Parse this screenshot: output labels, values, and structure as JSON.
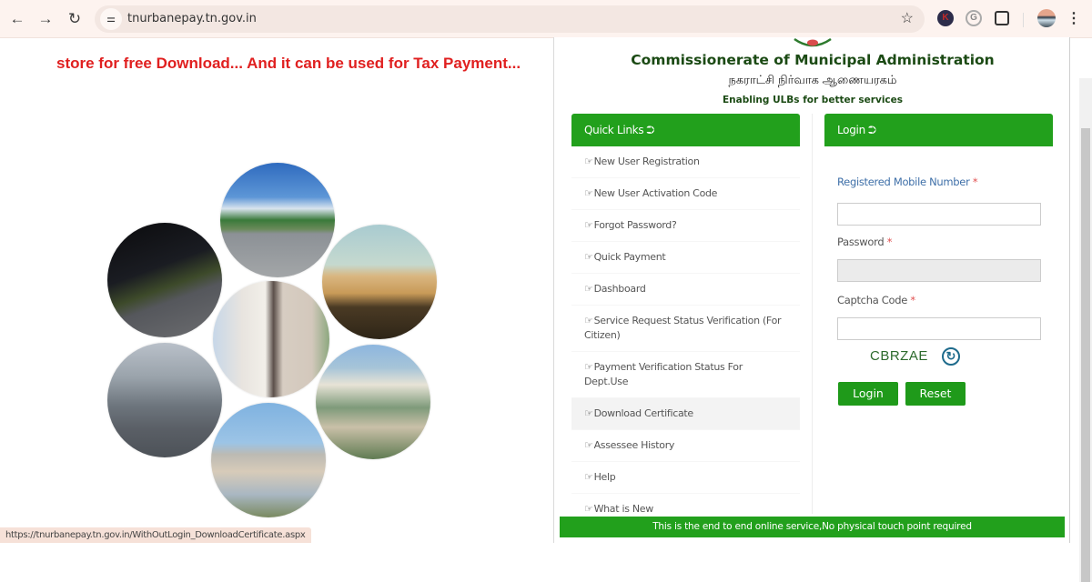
{
  "browser": {
    "url": "tnurbanepay.tn.gov.in",
    "icons": {
      "back": "arrow-left-icon",
      "forward": "arrow-right-icon",
      "reload": "reload-icon",
      "site_info": "tune-icon",
      "bookmark": "star-icon",
      "extension_k": "extension-k-icon",
      "extension_grammarly": "grammarly-icon",
      "extensions": "puzzle-icon",
      "profile": "avatar-icon",
      "menu": "kebab-menu-icon"
    },
    "glyphs": {
      "back": "←",
      "forward": "→",
      "reload": "↻",
      "site_info": "⚌",
      "bookmark": "☆",
      "extension_k": "K",
      "extension_grammarly": "G",
      "menu": "⋮"
    },
    "status_url": "https://tnurbanepay.tn.gov.in/WithOutLogin_DownloadCertificate.aspx"
  },
  "marquee": {
    "text": "store for free Download... And it can be used for Tax Payment...",
    "color": "#e02020"
  },
  "gallery": {
    "images": [
      "street-lights-road",
      "mountain-highway",
      "arch-bridge",
      "apartment-building",
      "city-traffic",
      "office-building",
      "water-tank"
    ]
  },
  "header": {
    "title": "Commissionerate of Municipal Administration",
    "tamil_title": "நகராட்சி நிர்வாக ஆணையரகம்",
    "tagline": "Enabling ULBs for better services"
  },
  "quick_links": {
    "title": "Quick Links",
    "header_icon": "⮊",
    "item_icon": "☞",
    "items": [
      {
        "label": "New User Registration"
      },
      {
        "label": "New User Activation Code"
      },
      {
        "label": "Forgot Password?"
      },
      {
        "label": "Quick Payment"
      },
      {
        "label": "Dashboard"
      },
      {
        "label": "Service Request Status Verification (For Citizen)"
      },
      {
        "label": "Payment Verification Status For Dept.Use"
      },
      {
        "label": "Download Certificate",
        "active": true
      },
      {
        "label": "Assessee History"
      },
      {
        "label": "Help"
      },
      {
        "label": "What is New"
      }
    ]
  },
  "login": {
    "title": "Login",
    "header_icon": "⮊",
    "mobile_label": "Registered Mobile Number",
    "password_label": "Password",
    "captcha_label": "Captcha Code",
    "required_mark": "*",
    "mobile_value": "",
    "password_value": "",
    "captcha_value": "",
    "captcha_text": "CBRZAE",
    "refresh_glyph": "↻",
    "login_button": "Login",
    "reset_button": "Reset"
  },
  "footer": {
    "text": "This is the end to end online service,No physical touch point required"
  },
  "colors": {
    "brand_green": "#22a01c",
    "title_green": "#1b4a14",
    "label_blue": "#3e6fa8",
    "required_red": "#e05050"
  }
}
